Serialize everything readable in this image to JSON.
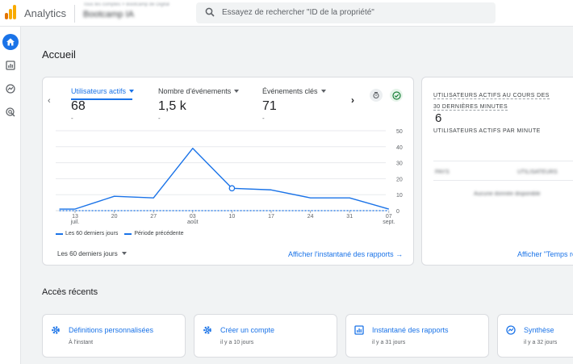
{
  "topbar": {
    "app_name": "Analytics",
    "account_line1": "Tous les comptes > Bootcamp de Digital",
    "account_line2": "Bootcamp IA",
    "search_placeholder": "Essayez de rechercher \"ID de la propriété\""
  },
  "nav": {
    "items": [
      {
        "name": "home-icon",
        "active": true
      },
      {
        "name": "reports-icon",
        "active": false
      },
      {
        "name": "explore-icon",
        "active": false
      },
      {
        "name": "advertising-icon",
        "active": false
      }
    ]
  },
  "page_title": "Accueil",
  "overview": {
    "metrics": [
      {
        "label": "Utilisateurs actifs",
        "value": "68",
        "delta": "-",
        "active": true
      },
      {
        "label": "Nombre d'événements",
        "value": "1,5 k",
        "delta": "-",
        "active": false
      },
      {
        "label": "Événements clés",
        "value": "71",
        "delta": "-",
        "active": false
      }
    ],
    "period_selector": "Les 60 derniers jours",
    "link": "Afficher l'instantané des rapports"
  },
  "chart_data": {
    "type": "line",
    "x": [
      "13 juil.",
      "20",
      "27",
      "03 août",
      "10",
      "17",
      "24",
      "31",
      "07 sept."
    ],
    "x_labels": [
      {
        "line1": "13",
        "line2": "juil."
      },
      {
        "line1": "20",
        "line2": ""
      },
      {
        "line1": "27",
        "line2": ""
      },
      {
        "line1": "03",
        "line2": "août"
      },
      {
        "line1": "10",
        "line2": ""
      },
      {
        "line1": "17",
        "line2": ""
      },
      {
        "line1": "24",
        "line2": ""
      },
      {
        "line1": "31",
        "line2": ""
      },
      {
        "line1": "07",
        "line2": "sept."
      }
    ],
    "series": [
      {
        "name": "Les 60 derniers jours",
        "style": "solid",
        "color": "#1a73e8",
        "points": [
          [
            -0.4,
            1
          ],
          [
            0,
            1
          ],
          [
            1,
            9
          ],
          [
            2,
            8
          ],
          [
            3,
            39
          ],
          [
            4,
            14
          ],
          [
            5,
            13
          ],
          [
            6,
            8
          ],
          [
            7,
            8
          ],
          [
            8,
            1
          ]
        ]
      },
      {
        "name": "Période précédente",
        "style": "dashed",
        "color": "#1a73e8",
        "points": [
          [
            -0.4,
            0
          ],
          [
            8,
            0
          ]
        ]
      }
    ],
    "highlight_index": 4,
    "y_ticks": [
      0,
      10,
      20,
      30,
      40,
      50
    ],
    "ylim": [
      0,
      50
    ],
    "grid": true,
    "legend_position": "bottom-left"
  },
  "realtime": {
    "title_line1": "UTILISATEURS ACTIFS AU COURS DES",
    "title_line2": "30 DERNIÈRES MINUTES",
    "value": "6",
    "sub_title": "UTILISATEURS ACTIFS PAR MINUTE",
    "col1": "PAYS",
    "col2": "UTILISATEURS",
    "empty_text": "Aucune donnée disponible",
    "link": "Afficher \"Temps ré"
  },
  "recent": {
    "title": "Accès récents",
    "items": [
      {
        "icon": "gear-icon",
        "label": "Définitions personnalisées",
        "time": "À l'instant"
      },
      {
        "icon": "gear-icon",
        "label": "Créer un compte",
        "time": "il y a 10 jours"
      },
      {
        "icon": "report-icon",
        "label": "Instantané des rapports",
        "time": "il y a 31 jours"
      },
      {
        "icon": "trend-icon",
        "label": "Synthèse",
        "time": "il y a 32 jours"
      }
    ]
  }
}
